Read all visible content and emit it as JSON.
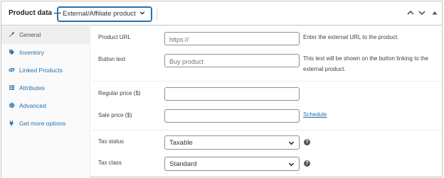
{
  "header": {
    "title": "Product data —",
    "product_type": "External/Affiliate product",
    "controls": [
      "chevron-up-icon",
      "chevron-down-icon",
      "collapse-triangle-icon"
    ]
  },
  "sidebar": {
    "items": [
      {
        "label": "General",
        "icon": "wrench-icon",
        "active": true
      },
      {
        "label": "Inventory",
        "icon": "tag-icon",
        "active": false
      },
      {
        "label": "Linked Products",
        "icon": "link-icon",
        "active": false
      },
      {
        "label": "Attributes",
        "icon": "table-icon",
        "active": false
      },
      {
        "label": "Advanced",
        "icon": "gear-icon",
        "active": false
      },
      {
        "label": "Get more options",
        "icon": "plugin-icon",
        "active": false
      }
    ]
  },
  "general": {
    "product_url": {
      "label": "Product URL",
      "placeholder": "https://",
      "description": "Enter the external URL to the product."
    },
    "button_text": {
      "label": "Button text",
      "placeholder": "Buy product",
      "description_line1": "This text will be shown on the button linking to the",
      "description_line2": "external product."
    },
    "regular_price": {
      "label": "Regular price ($)",
      "value": ""
    },
    "sale_price": {
      "label": "Sale price ($)",
      "value": "",
      "schedule_link": "Schedule"
    },
    "tax_status": {
      "label": "Tax status",
      "value": "Taxable"
    },
    "tax_class": {
      "label": "Tax class",
      "value": "Standard"
    }
  },
  "colors": {
    "accent": "#2271b1",
    "border": "#c3c4c7",
    "sidebar_bg": "#fafafa",
    "active_tab_bg": "#eeeeee"
  }
}
